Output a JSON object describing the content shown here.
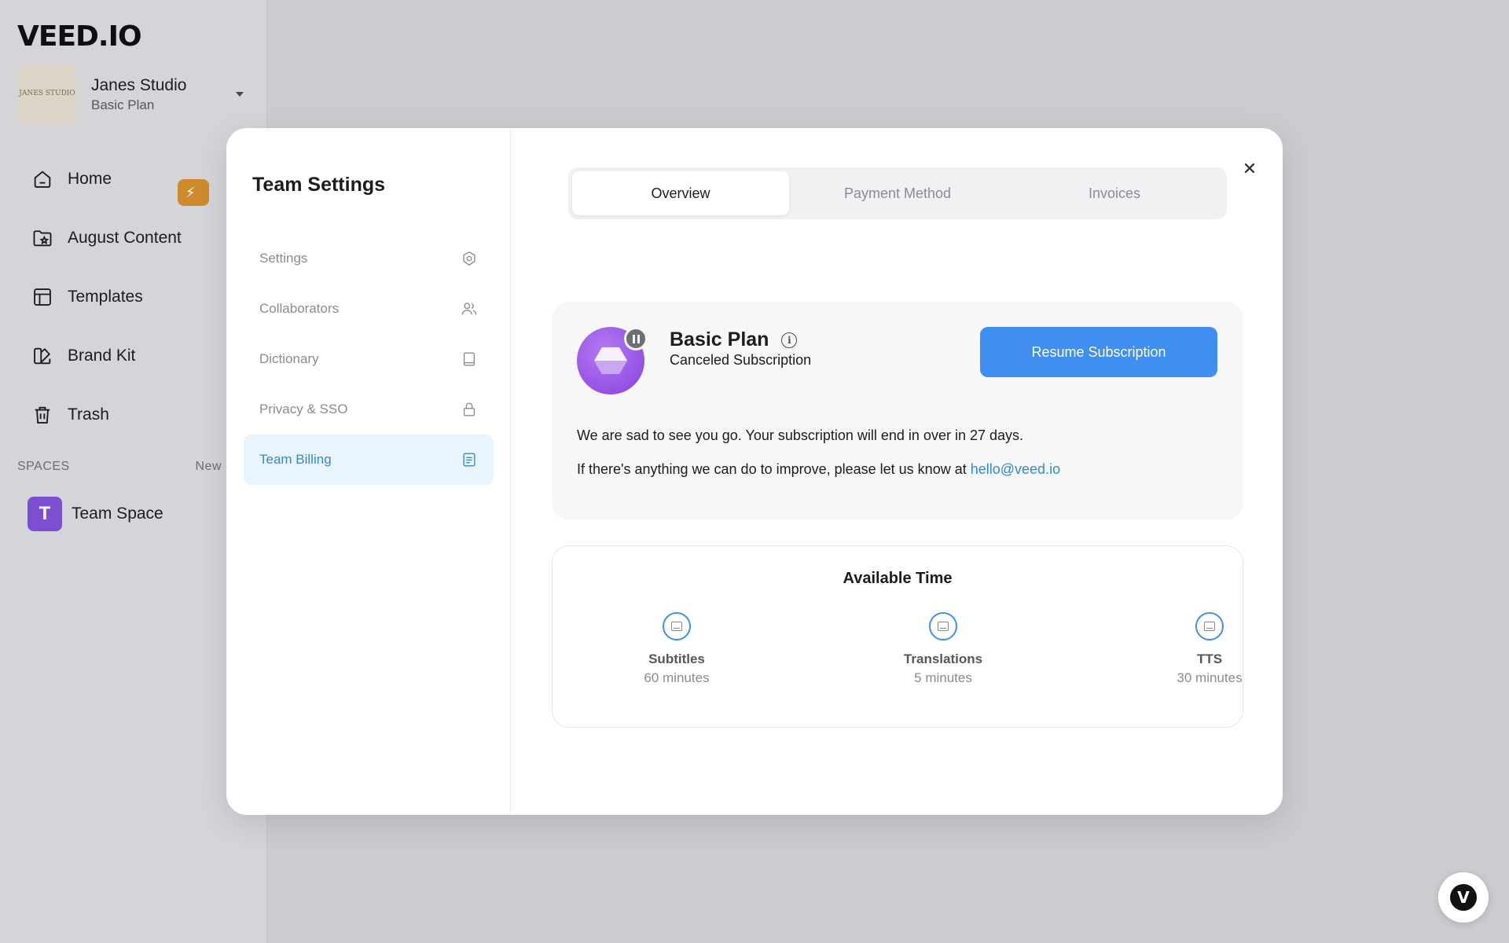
{
  "app": {
    "logo": "VEED.IO"
  },
  "workspace": {
    "name": "Janes Studio",
    "plan": "Basic Plan",
    "avatar_text": "JANES STUDIO"
  },
  "sidebar": {
    "items": [
      {
        "label": "Home",
        "icon": "home-icon"
      },
      {
        "label": "August Content",
        "icon": "folder-star-icon"
      },
      {
        "label": "Templates",
        "icon": "templates-icon"
      },
      {
        "label": "Brand Kit",
        "icon": "brand-kit-icon"
      },
      {
        "label": "Trash",
        "icon": "trash-icon"
      }
    ],
    "spaces_header": "SPACES",
    "spaces_new": "New",
    "spaces": [
      {
        "initial": "T",
        "label": "Team Space"
      }
    ]
  },
  "modal": {
    "title": "Team Settings",
    "nav": [
      {
        "label": "Settings",
        "icon": "gear-icon",
        "active": false
      },
      {
        "label": "Collaborators",
        "icon": "users-icon",
        "active": false
      },
      {
        "label": "Dictionary",
        "icon": "book-icon",
        "active": false
      },
      {
        "label": "Privacy & SSO",
        "icon": "lock-icon",
        "active": false
      },
      {
        "label": "Team Billing",
        "icon": "billing-icon",
        "active": true
      }
    ],
    "tabs": [
      {
        "label": "Overview",
        "active": true
      },
      {
        "label": "Payment Method",
        "active": false
      },
      {
        "label": "Invoices",
        "active": false
      }
    ],
    "plan": {
      "name": "Basic Plan",
      "status": "Canceled Subscription",
      "resume_label": "Resume Subscription",
      "message": "We are sad to see you go. Your subscription will end in over in 27 days.",
      "improve_text": "If there's anything we can do to improve, please let us know at",
      "email": "hello@veed.io"
    },
    "available_time": {
      "title": "Available Time",
      "items": [
        {
          "label": "Subtitles",
          "value": "60 minutes"
        },
        {
          "label": "Translations",
          "value": "5 minutes"
        },
        {
          "label": "TTS",
          "value": "30 minutes"
        }
      ]
    }
  },
  "colors": {
    "accent": "#3e8ff0",
    "active_nav": "#2f8ccb",
    "plan_purple": "#8a3fe0"
  }
}
